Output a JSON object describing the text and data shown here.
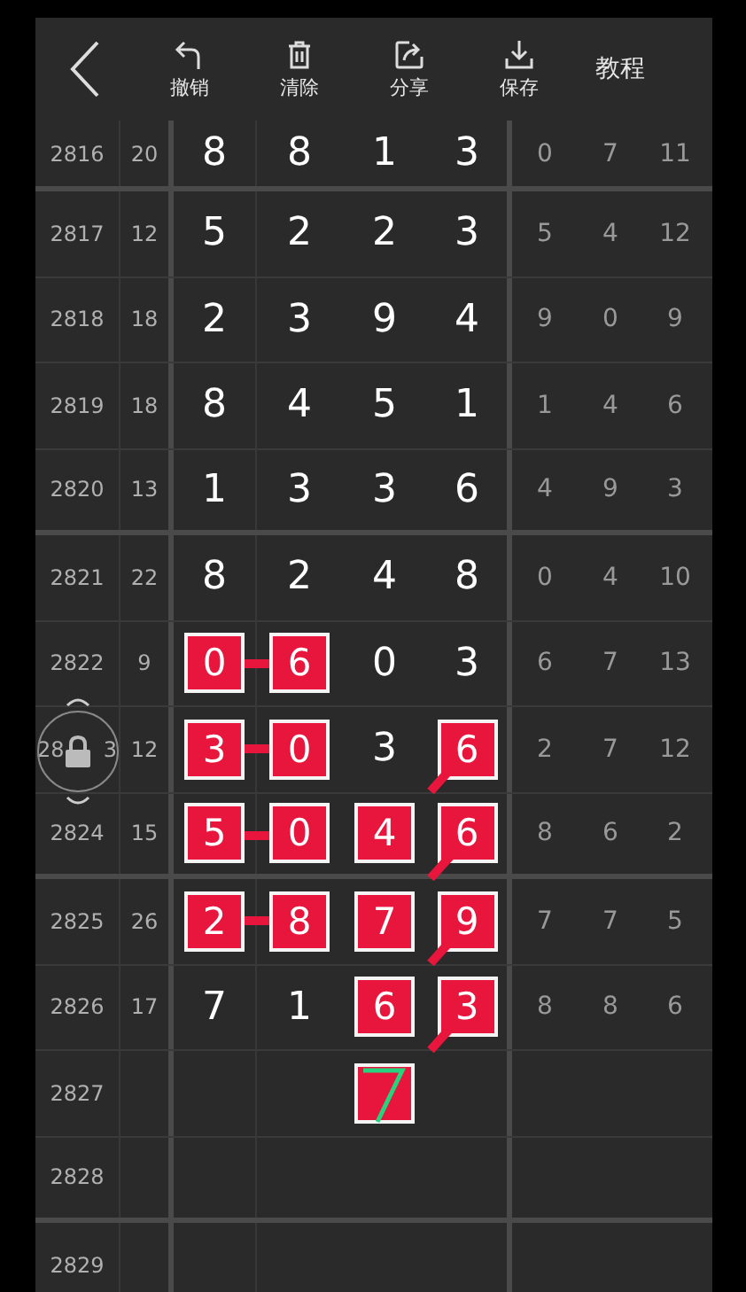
{
  "toolbar": {
    "actions": [
      {
        "label": "撤销"
      },
      {
        "label": "清除"
      },
      {
        "label": "分享"
      },
      {
        "label": "保存"
      }
    ],
    "help": "教程"
  },
  "rows": [
    {
      "issue": "2816",
      "sum": "20",
      "digits": [
        {
          "value": "8",
          "marked": false
        },
        {
          "value": "8",
          "marked": false
        },
        {
          "value": "1",
          "marked": false
        },
        {
          "value": "3",
          "marked": false
        }
      ],
      "extra": [
        "0",
        "7",
        "11"
      ],
      "divider_below": true
    },
    {
      "issue": "2817",
      "sum": "12",
      "digits": [
        {
          "value": "5",
          "marked": false
        },
        {
          "value": "2",
          "marked": false
        },
        {
          "value": "2",
          "marked": false
        },
        {
          "value": "3",
          "marked": false
        }
      ],
      "extra": [
        "5",
        "4",
        "12"
      ]
    },
    {
      "issue": "2818",
      "sum": "18",
      "digits": [
        {
          "value": "2",
          "marked": false
        },
        {
          "value": "3",
          "marked": false
        },
        {
          "value": "9",
          "marked": false
        },
        {
          "value": "4",
          "marked": false
        }
      ],
      "extra": [
        "9",
        "0",
        "9"
      ]
    },
    {
      "issue": "2819",
      "sum": "18",
      "digits": [
        {
          "value": "8",
          "marked": false
        },
        {
          "value": "4",
          "marked": false
        },
        {
          "value": "5",
          "marked": false
        },
        {
          "value": "1",
          "marked": false
        }
      ],
      "extra": [
        "1",
        "4",
        "6"
      ]
    },
    {
      "issue": "2820",
      "sum": "13",
      "digits": [
        {
          "value": "1",
          "marked": false
        },
        {
          "value": "3",
          "marked": false
        },
        {
          "value": "3",
          "marked": false
        },
        {
          "value": "6",
          "marked": false
        }
      ],
      "extra": [
        "4",
        "9",
        "3"
      ],
      "divider_below": true
    },
    {
      "issue": "2821",
      "sum": "22",
      "digits": [
        {
          "value": "8",
          "marked": false
        },
        {
          "value": "2",
          "marked": false
        },
        {
          "value": "4",
          "marked": false
        },
        {
          "value": "8",
          "marked": false
        }
      ],
      "extra": [
        "0",
        "4",
        "10"
      ]
    },
    {
      "issue": "2822",
      "sum": "9",
      "digits": [
        {
          "value": "0",
          "marked": true,
          "link_right": true
        },
        {
          "value": "6",
          "marked": true
        },
        {
          "value": "0",
          "marked": false
        },
        {
          "value": "3",
          "marked": false
        }
      ],
      "extra": [
        "6",
        "7",
        "13"
      ]
    },
    {
      "issue_parts": [
        "28",
        "3"
      ],
      "sum": "12",
      "lock_handle": true,
      "digits": [
        {
          "value": "3",
          "marked": true,
          "link_right": true
        },
        {
          "value": "0",
          "marked": true
        },
        {
          "value": "3",
          "marked": false
        },
        {
          "value": "6",
          "marked": true,
          "link_down_left": true
        }
      ],
      "extra": [
        "2",
        "7",
        "12"
      ]
    },
    {
      "issue": "2824",
      "sum": "15",
      "digits": [
        {
          "value": "5",
          "marked": true,
          "link_right": true
        },
        {
          "value": "0",
          "marked": true
        },
        {
          "value": "4",
          "marked": true
        },
        {
          "value": "6",
          "marked": true,
          "link_down_left": true
        }
      ],
      "extra": [
        "8",
        "6",
        "2"
      ],
      "divider_below": true
    },
    {
      "issue": "2825",
      "sum": "26",
      "digits": [
        {
          "value": "2",
          "marked": true,
          "link_right": true
        },
        {
          "value": "8",
          "marked": true
        },
        {
          "value": "7",
          "marked": true
        },
        {
          "value": "9",
          "marked": true,
          "link_down_left": true
        }
      ],
      "extra": [
        "7",
        "7",
        "5"
      ]
    },
    {
      "issue": "2826",
      "sum": "17",
      "digits": [
        {
          "value": "7",
          "marked": false
        },
        {
          "value": "1",
          "marked": false
        },
        {
          "value": "6",
          "marked": true
        },
        {
          "value": "3",
          "marked": true,
          "link_down_left": true
        }
      ],
      "extra": [
        "8",
        "8",
        "6"
      ]
    },
    {
      "issue": "2827",
      "digits": [
        {
          "marked": false
        },
        {
          "marked": false
        },
        {
          "marked": true,
          "scribble": true
        },
        {
          "marked": false
        }
      ]
    },
    {
      "issue": "2828",
      "divider_below": true
    },
    {
      "issue": "2829"
    }
  ]
}
